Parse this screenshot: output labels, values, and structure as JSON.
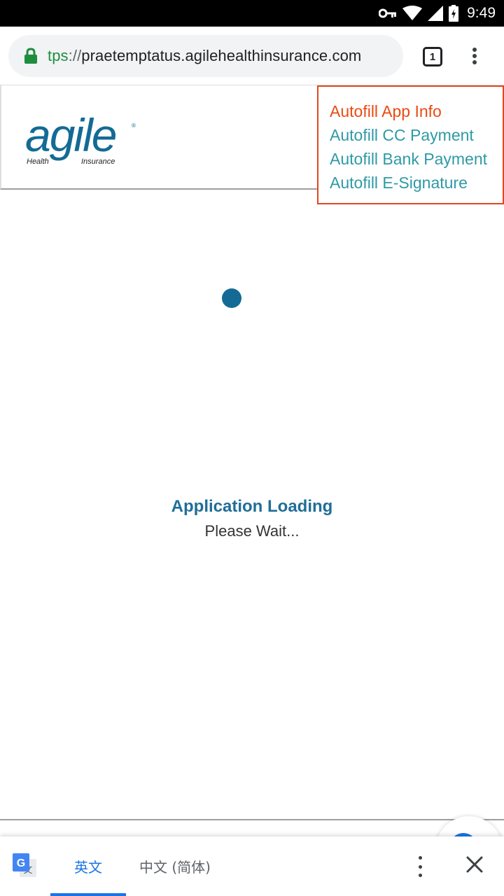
{
  "status_bar": {
    "time": "9:49",
    "icons": [
      "vpn-key-icon",
      "wifi-icon",
      "signal-icon",
      "battery-charging-icon"
    ]
  },
  "browser": {
    "url_scheme": "tps",
    "url_separator": "://",
    "url_host": "praetemptatus.agilehealthinsurance.com",
    "tab_count": "1",
    "secure_color": "#1e8e3e"
  },
  "site": {
    "logo_word": "agile",
    "logo_sub_left": "Health",
    "logo_sub_right": "Insurance",
    "brand_color": "#136b95"
  },
  "autofill": {
    "items": [
      {
        "label": "Autofill App Info",
        "active": true
      },
      {
        "label": "Autofill CC Payment",
        "active": false
      },
      {
        "label": "Autofill Bank Payment",
        "active": false
      },
      {
        "label": "Autofill E-Signature",
        "active": false
      }
    ],
    "active_color": "#ea4b12",
    "link_color": "#2f9aa6",
    "border_color": "#e0481d"
  },
  "loading": {
    "title": "Application Loading",
    "subtitle": "Please Wait..."
  },
  "translate_bar": {
    "source_language": "英文",
    "target_language": "中文 (简体)",
    "accent_color": "#1a73e8"
  }
}
